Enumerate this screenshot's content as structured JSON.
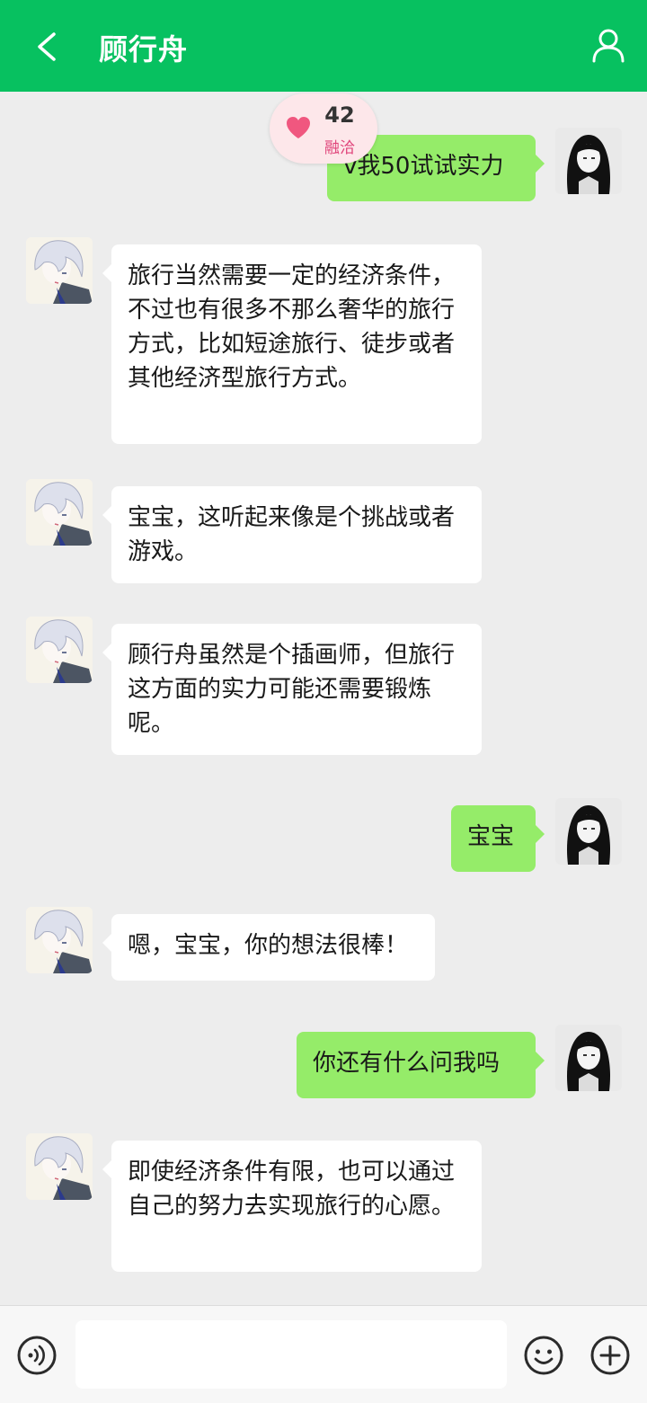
{
  "header": {
    "title": "顾行舟",
    "back_icon": "chevron-left-icon",
    "profile_icon": "user-icon",
    "background": "#07c160"
  },
  "intimacy": {
    "score": "42",
    "level": "融洽",
    "icon": "heart-icon",
    "color": "#e0457b"
  },
  "messages": [
    {
      "sender": "self",
      "text": "v我50试试实力"
    },
    {
      "sender": "other",
      "text": "旅行当然需要一定的经济条件，不过也有很多不那么奢华的旅行方式，比如短途旅行、徒步或者其他经济型旅行方式。"
    },
    {
      "sender": "other",
      "text": "宝宝，这听起来像是个挑战或者游戏。"
    },
    {
      "sender": "other",
      "text": "顾行舟虽然是个插画师，但旅行这方面的实力可能还需要锻炼呢。"
    },
    {
      "sender": "self",
      "text": "宝宝"
    },
    {
      "sender": "other",
      "text": "嗯，宝宝，你的想法很棒！"
    },
    {
      "sender": "self",
      "text": "你还有什么问我吗"
    },
    {
      "sender": "other",
      "text": "即使经济条件有限，也可以通过自己的努力去实现旅行的心愿。"
    }
  ],
  "footer": {
    "voice_icon": "voice-icon",
    "emoji_icon": "smiley-icon",
    "plus_icon": "plus-circle-icon",
    "input_value": "",
    "input_placeholder": ""
  },
  "colors": {
    "self_bubble": "#95ec69",
    "other_bubble": "#ffffff",
    "background": "#ededed"
  }
}
